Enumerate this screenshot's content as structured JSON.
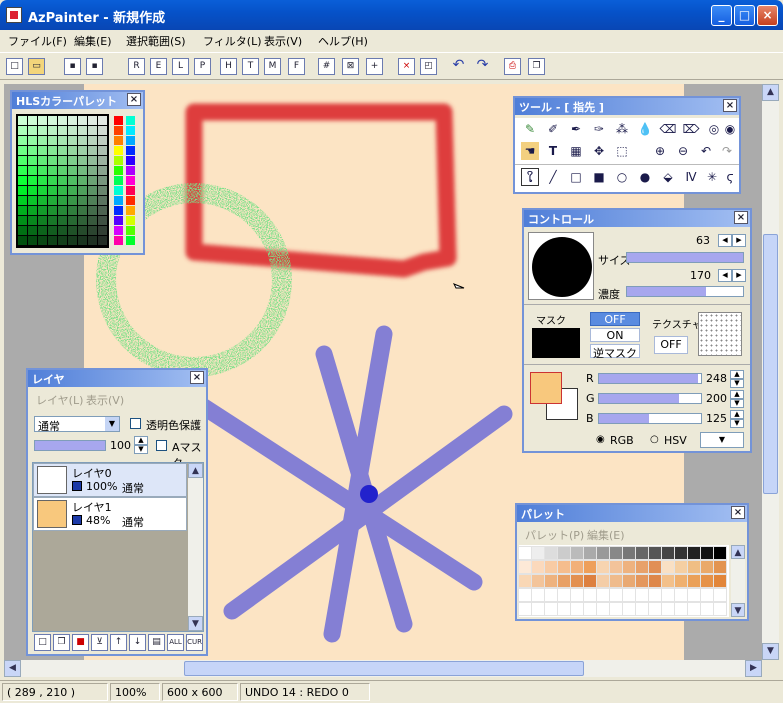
{
  "window": {
    "title": "AzPainter - 新規作成",
    "min": "_",
    "max": "□",
    "close": "×"
  },
  "menu": [
    "ファイル(F)",
    "編集(E)",
    "選択範囲(S)",
    "フィルタ(L)",
    "表示(V)",
    "ヘルプ(H)"
  ],
  "toolbar": {
    "icons": [
      "new-icon",
      "open-icon",
      "save-icon",
      "save-as-icon",
      "tool-a-icon",
      "tool-b-icon",
      "tool-c-icon",
      "tool-d-icon",
      "tool-e-icon",
      "tool-f-icon",
      "tool-g-icon",
      "tool-h-icon",
      "grid-icon",
      "grid-cross-icon",
      "grid-plus-icon",
      "close-doc-icon",
      "crop-icon",
      "undo-icon",
      "redo-icon",
      "print-icon",
      "copy-icon"
    ]
  },
  "hls": {
    "title": "HLSカラーパレット"
  },
  "tool_panel": {
    "title": "ツール - [ 指先 ]"
  },
  "control": {
    "title": "コントロール",
    "size_label": "サイズ",
    "size": "63",
    "density_label": "濃度",
    "density": "170",
    "density_pct": 0.68,
    "size_pct": 1.0,
    "mask_label": "マスク",
    "mask_off": "OFF",
    "mask_on": "ON",
    "mask_inv": "逆マスク",
    "texture_label": "テクスチャ",
    "texture_off": "OFF",
    "r_label": "R",
    "g_label": "G",
    "b_label": "B",
    "r": "248",
    "g": "200",
    "b": "125",
    "r_pct": 0.97,
    "g_pct": 0.78,
    "b_pct": 0.49,
    "rgb_label": "RGB",
    "hsv_label": "HSV",
    "fg_color": "#f8c87d",
    "bg_color": "#ffffff"
  },
  "layer": {
    "title": "レイヤ",
    "menu_layer": "レイヤ(L)",
    "menu_view": "表示(V)",
    "blend": "通常",
    "protect_label": "透明色保護",
    "opacity": "100",
    "amask_label": "Aマスク",
    "layers": [
      {
        "name": "レイヤ0",
        "opacity": "100%",
        "mode": "通常"
      },
      {
        "name": "レイヤ1",
        "opacity": "48%",
        "mode": "通常"
      }
    ],
    "foot": [
      "ALL",
      "CUR"
    ]
  },
  "palette": {
    "title": "パレット",
    "menu_palette": "パレット(P)",
    "menu_edit": "編集(E)"
  },
  "status": {
    "coords": "( 289 , 210 )",
    "zoom": "100%",
    "size": "600 x 600",
    "undo": "UNDO 14 : REDO 0"
  }
}
